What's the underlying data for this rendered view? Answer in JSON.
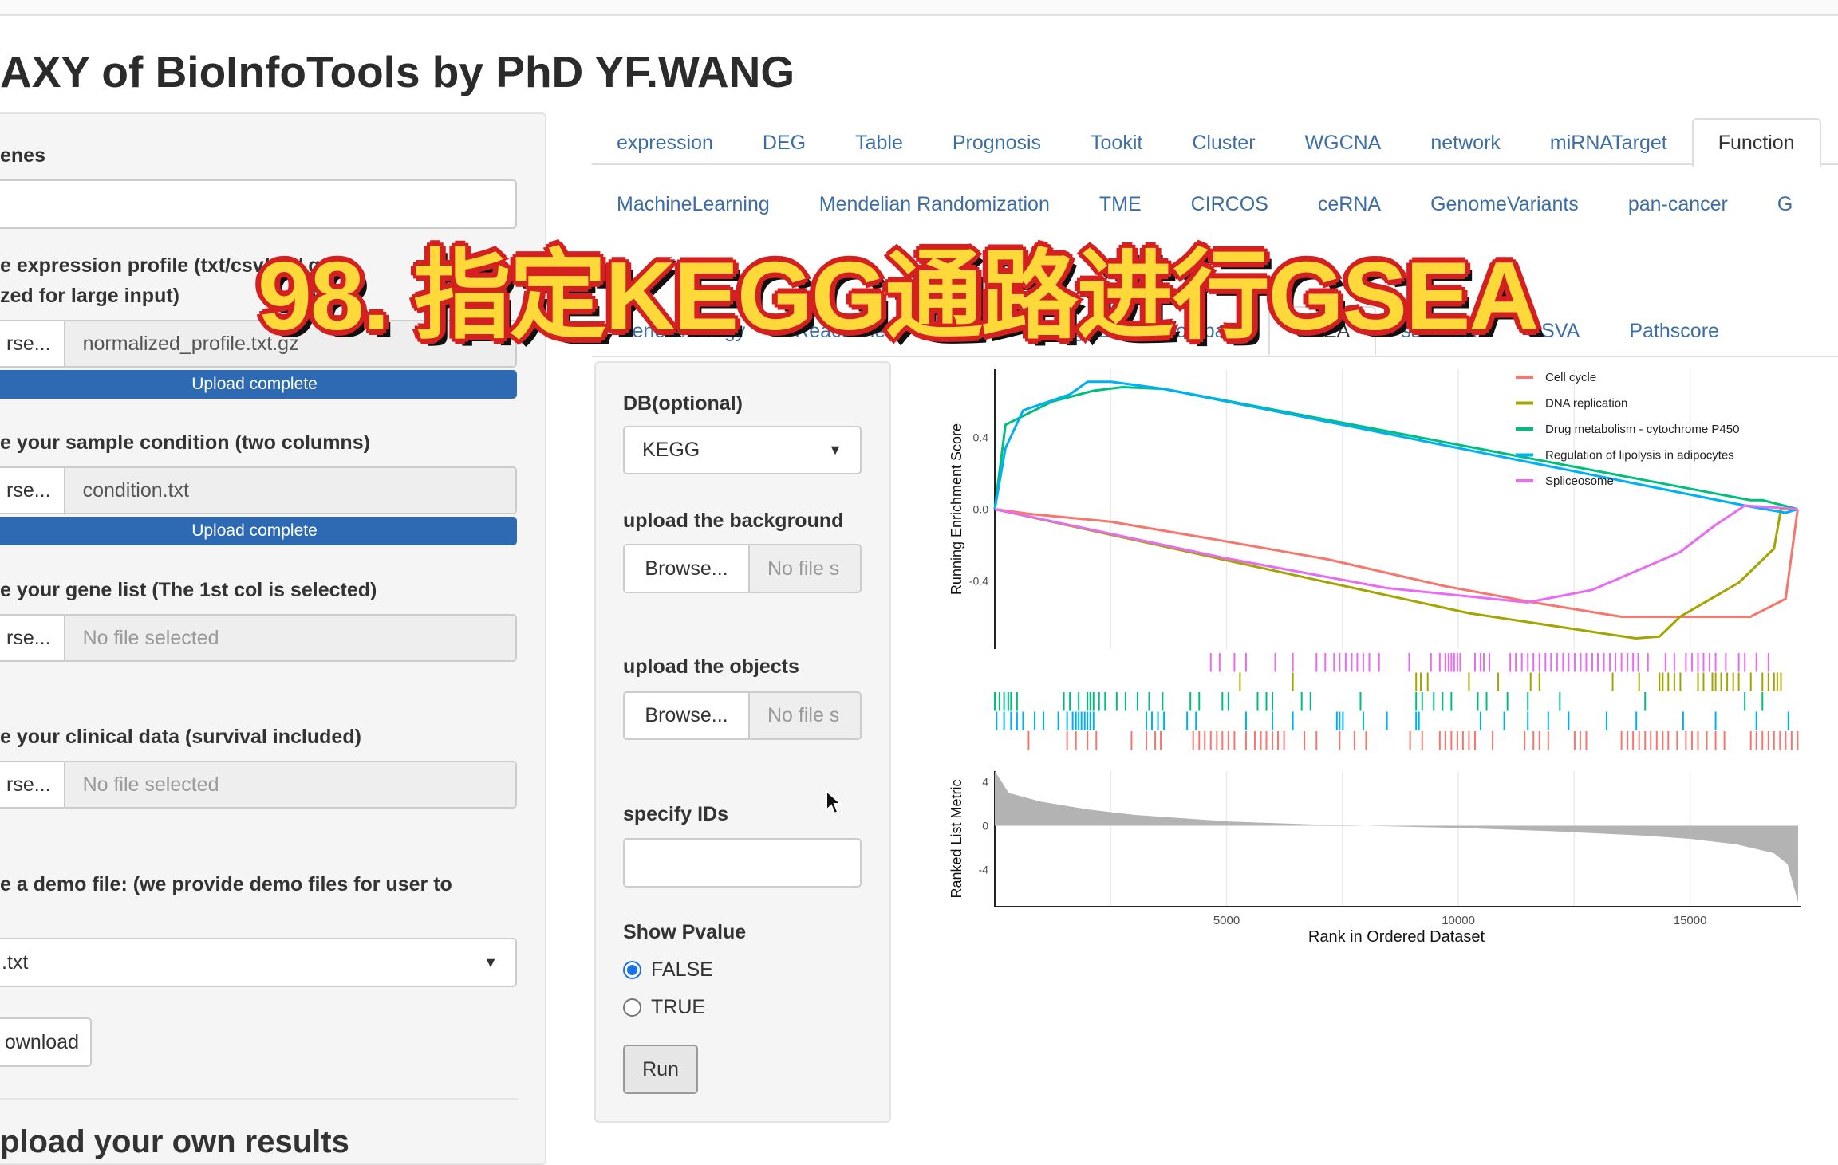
{
  "app": {
    "title": "AXY of BioInfoTools by PhD YF.WANG"
  },
  "overlay_caption": "98. 指定KEGG通路进行GSEA",
  "tabs": {
    "row1": [
      "expression",
      "DEG",
      "Table",
      "Prognosis",
      "Tookit",
      "Cluster",
      "WGCNA",
      "network",
      "miRNATarget",
      "Function"
    ],
    "row1_active": "Function",
    "row2": [
      "MachineLearning",
      "Mendelian Randomization",
      "TME",
      "CIRCOS",
      "ceRNA",
      "GenomeVariants",
      "pan-cancer",
      "G"
    ],
    "row3": [
      "GeneOntology",
      "Reactome",
      "KEGG",
      "MsigDB",
      "Compare",
      "GSEA",
      "ssGSEA",
      "GSVA",
      "Pathscore"
    ],
    "row3_active": "GSEA"
  },
  "left": {
    "genes_label": "enes",
    "genes_value": "",
    "expr_label_1": "e expression profile (txt/csv/zip/.gz",
    "expr_label_2": "zed for large input)",
    "expr_browse": "rse...",
    "expr_file": "normalized_profile.txt.gz",
    "expr_progress": "Upload complete",
    "cond_label": "e your sample condition (two columns)",
    "cond_browse": "rse...",
    "cond_file": "condition.txt",
    "cond_progress": "Upload complete",
    "genelist_label": "e your gene list (The 1st col is selected)",
    "genelist_browse": "rse...",
    "genelist_file": "No file selected",
    "clinical_label": "e your clinical data (survival included)",
    "clinical_browse": "rse...",
    "clinical_file": "No file selected",
    "demo_label": "e a demo file: (we provide demo files for user to",
    "demo_select": ".txt",
    "download_label": "ownload",
    "upload_heading": "pload your own results"
  },
  "middle": {
    "db_label": "DB(optional)",
    "db_value": "KEGG",
    "background_label": "upload the background",
    "background_browse": "Browse...",
    "background_file": "No file s",
    "objects_label": "upload the objects",
    "objects_browse": "Browse...",
    "objects_file": "No file s",
    "ids_label": "specify IDs",
    "ids_value": "",
    "pvalue_label": "Show Pvalue",
    "pvalue_options": [
      "FALSE",
      "TRUE"
    ],
    "pvalue_selected": "FALSE",
    "run_label": "Run"
  },
  "chart_data": {
    "type": "line",
    "title": "",
    "xlabel": "Rank in Ordered Dataset",
    "ylabel_es": "Running Enrichment Score",
    "ylabel_metric": "Ranked List Metric",
    "xlim": [
      0,
      17330
    ],
    "x_ticks": [
      "5000",
      "10000",
      "15000"
    ],
    "es_ylim": [
      -0.78,
      0.78
    ],
    "es_ticks": [
      "0.4",
      "0.0",
      "-0.4"
    ],
    "metric_ylim": [
      -7.4,
      5
    ],
    "metric_ticks": [
      "4",
      "0",
      "-4"
    ],
    "legend_position": "top-right",
    "grid": "vertical",
    "series": [
      {
        "name": "Cell cycle",
        "color": "#F8766D",
        "es": [
          [
            0,
            0
          ],
          [
            730,
            -0.026
          ],
          [
            2500,
            -0.07
          ],
          [
            4660,
            -0.165
          ],
          [
            7190,
            -0.28
          ],
          [
            9720,
            -0.43
          ],
          [
            11620,
            -0.52
          ],
          [
            13520,
            -0.6
          ],
          [
            14780,
            -0.6
          ],
          [
            16300,
            -0.6
          ],
          [
            17060,
            -0.5
          ],
          [
            17320,
            0
          ]
        ],
        "hits": [
          730,
          1560,
          1750,
          2000,
          2190,
          2950,
          3270,
          3460,
          3580,
          4280,
          4410,
          4530,
          4660,
          4790,
          4910,
          5040,
          5170,
          5420,
          5610,
          5740,
          5860,
          5990,
          6110,
          6240,
          6680,
          6940,
          7440,
          7760,
          8010,
          8960,
          9220,
          9600,
          9720,
          9850,
          9980,
          10100,
          10230,
          10360,
          10740,
          11430,
          11620,
          11750,
          11940,
          12510,
          12630,
          12760,
          13520,
          13650,
          13770,
          13900,
          14030,
          14150,
          14280,
          14410,
          14530,
          14720,
          14910,
          15040,
          15170,
          15360,
          15550,
          15740,
          16310,
          16430,
          16560,
          16690,
          16810,
          16940,
          17060,
          17190,
          17320
        ]
      },
      {
        "name": "DNA replication",
        "color": "#A3A500",
        "es": [
          [
            0,
            0
          ],
          [
            4910,
            -0.28
          ],
          [
            10230,
            -0.58
          ],
          [
            13830,
            -0.72
          ],
          [
            14340,
            -0.71
          ],
          [
            14780,
            -0.6
          ],
          [
            16050,
            -0.41
          ],
          [
            16810,
            -0.22
          ],
          [
            16960,
            0
          ],
          [
            17320,
            0
          ]
        ],
        "hits": [
          5290,
          6430,
          9090,
          9190,
          9340,
          10230,
          10860,
          11560,
          11750,
          13330,
          13900,
          14340,
          14410,
          14530,
          14660,
          14790,
          15170,
          15290,
          15480,
          15550,
          15670,
          15800,
          15930,
          16050,
          16310,
          16560,
          16690,
          16810,
          16880,
          16960
        ]
      },
      {
        "name": "Drug metabolism - cytochrome P450",
        "color": "#00BF7D",
        "es": [
          [
            0,
            0
          ],
          [
            230,
            0.47
          ],
          [
            1240,
            0.6
          ],
          [
            2130,
            0.66
          ],
          [
            2760,
            0.68
          ],
          [
            3650,
            0.67
          ],
          [
            16300,
            0.05
          ],
          [
            16560,
            0.05
          ],
          [
            17320,
            0
          ]
        ],
        "hits": [
          0,
          100,
          200,
          290,
          350,
          480,
          1490,
          1620,
          1810,
          2000,
          2060,
          2130,
          2250,
          2380,
          2630,
          2820,
          3080,
          3330,
          3620,
          4220,
          4410,
          4910,
          5040,
          5670,
          5860,
          5990,
          6620,
          6810,
          7890,
          9090,
          9220,
          9470,
          9660,
          9850,
          10420,
          10610,
          11060,
          11500,
          12190,
          14030,
          16180,
          16560
        ]
      },
      {
        "name": "Regulation of lipolysis in adipocytes",
        "color": "#00B0F6",
        "es": [
          [
            0,
            0
          ],
          [
            230,
            0.34
          ],
          [
            610,
            0.55
          ],
          [
            1620,
            0.64
          ],
          [
            2000,
            0.71
          ],
          [
            2510,
            0.71
          ],
          [
            3650,
            0.67
          ],
          [
            16180,
            0.02
          ],
          [
            17060,
            -0.02
          ],
          [
            17320,
            0
          ]
        ],
        "hits": [
          40,
          200,
          350,
          480,
          610,
          860,
          1050,
          1370,
          1560,
          1680,
          1750,
          1810,
          1870,
          1940,
          2000,
          2060,
          2130,
          3270,
          3390,
          3520,
          3650,
          4150,
          4340,
          5420,
          5990,
          6430,
          7380,
          7440,
          7510,
          7950,
          8460,
          9090,
          9150,
          10480,
          10990,
          11500,
          11940,
          12380,
          13200,
          13840,
          14850,
          15550,
          16430,
          17120
        ]
      },
      {
        "name": "Spliceosome",
        "color": "#E76BF3",
        "es": [
          [
            0,
            0
          ],
          [
            4910,
            -0.27
          ],
          [
            8460,
            -0.44
          ],
          [
            11490,
            -0.52
          ],
          [
            12890,
            -0.45
          ],
          [
            14780,
            -0.24
          ],
          [
            15540,
            -0.09
          ],
          [
            16180,
            0.02
          ],
          [
            17320,
            0
          ]
        ],
        "hits": [
          4660,
          4850,
          5170,
          5420,
          6050,
          6430,
          6940,
          7130,
          7320,
          7440,
          7570,
          7700,
          7820,
          7950,
          8080,
          8290,
          8940,
          9410,
          9600,
          9720,
          9790,
          9850,
          9910,
          9980,
          10040,
          10360,
          10480,
          10550,
          10670,
          11120,
          11240,
          11370,
          11500,
          11620,
          11750,
          11880,
          12000,
          12130,
          12260,
          12380,
          12510,
          12640,
          12760,
          12890,
          13010,
          13140,
          13270,
          13390,
          13520,
          13650,
          13770,
          13880,
          14090,
          14470,
          14660,
          14910,
          15040,
          15170,
          15290,
          15420,
          15550,
          15770,
          16050,
          16180,
          16430,
          16690
        ]
      }
    ],
    "ranked_metric": [
      [
        0,
        5
      ],
      [
        300,
        3
      ],
      [
        1000,
        2.2
      ],
      [
        2000,
        1.5
      ],
      [
        3000,
        1.0
      ],
      [
        5000,
        0.4
      ],
      [
        7000,
        0.1
      ],
      [
        8000,
        0
      ],
      [
        10000,
        -0.2
      ],
      [
        12000,
        -0.5
      ],
      [
        14000,
        -0.9
      ],
      [
        15000,
        -1.2
      ],
      [
        16000,
        -1.7
      ],
      [
        16800,
        -2.5
      ],
      [
        17100,
        -3.5
      ],
      [
        17330,
        -7
      ]
    ]
  }
}
